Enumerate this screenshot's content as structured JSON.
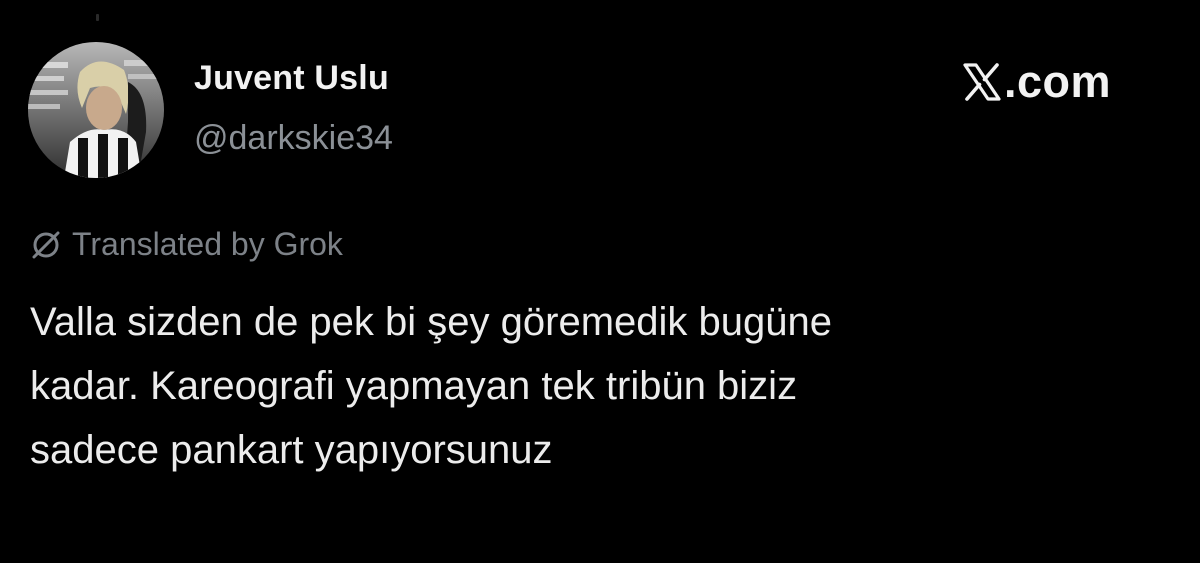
{
  "user": {
    "display_name": "Juvent Uslu",
    "handle": "@darkskie34",
    "avatar_icon": "profile-photo"
  },
  "brand": {
    "logo_icon": "x-logo-icon",
    "suffix": ".com"
  },
  "translation": {
    "icon": "grok-icon",
    "label": "Translated by Grok"
  },
  "tweet": {
    "lines": [
      "Valla sizden de pek bi şey göremedik bugüne",
      "kadar. Kareografi yapmayan tek tribün biziz",
      "sadece pankart yapıyorsunuz"
    ]
  },
  "colors": {
    "background": "#000000",
    "name": "#f2f2f2",
    "handle": "#8b9096",
    "muted": "#7d8288",
    "body_text": "#ececec"
  }
}
